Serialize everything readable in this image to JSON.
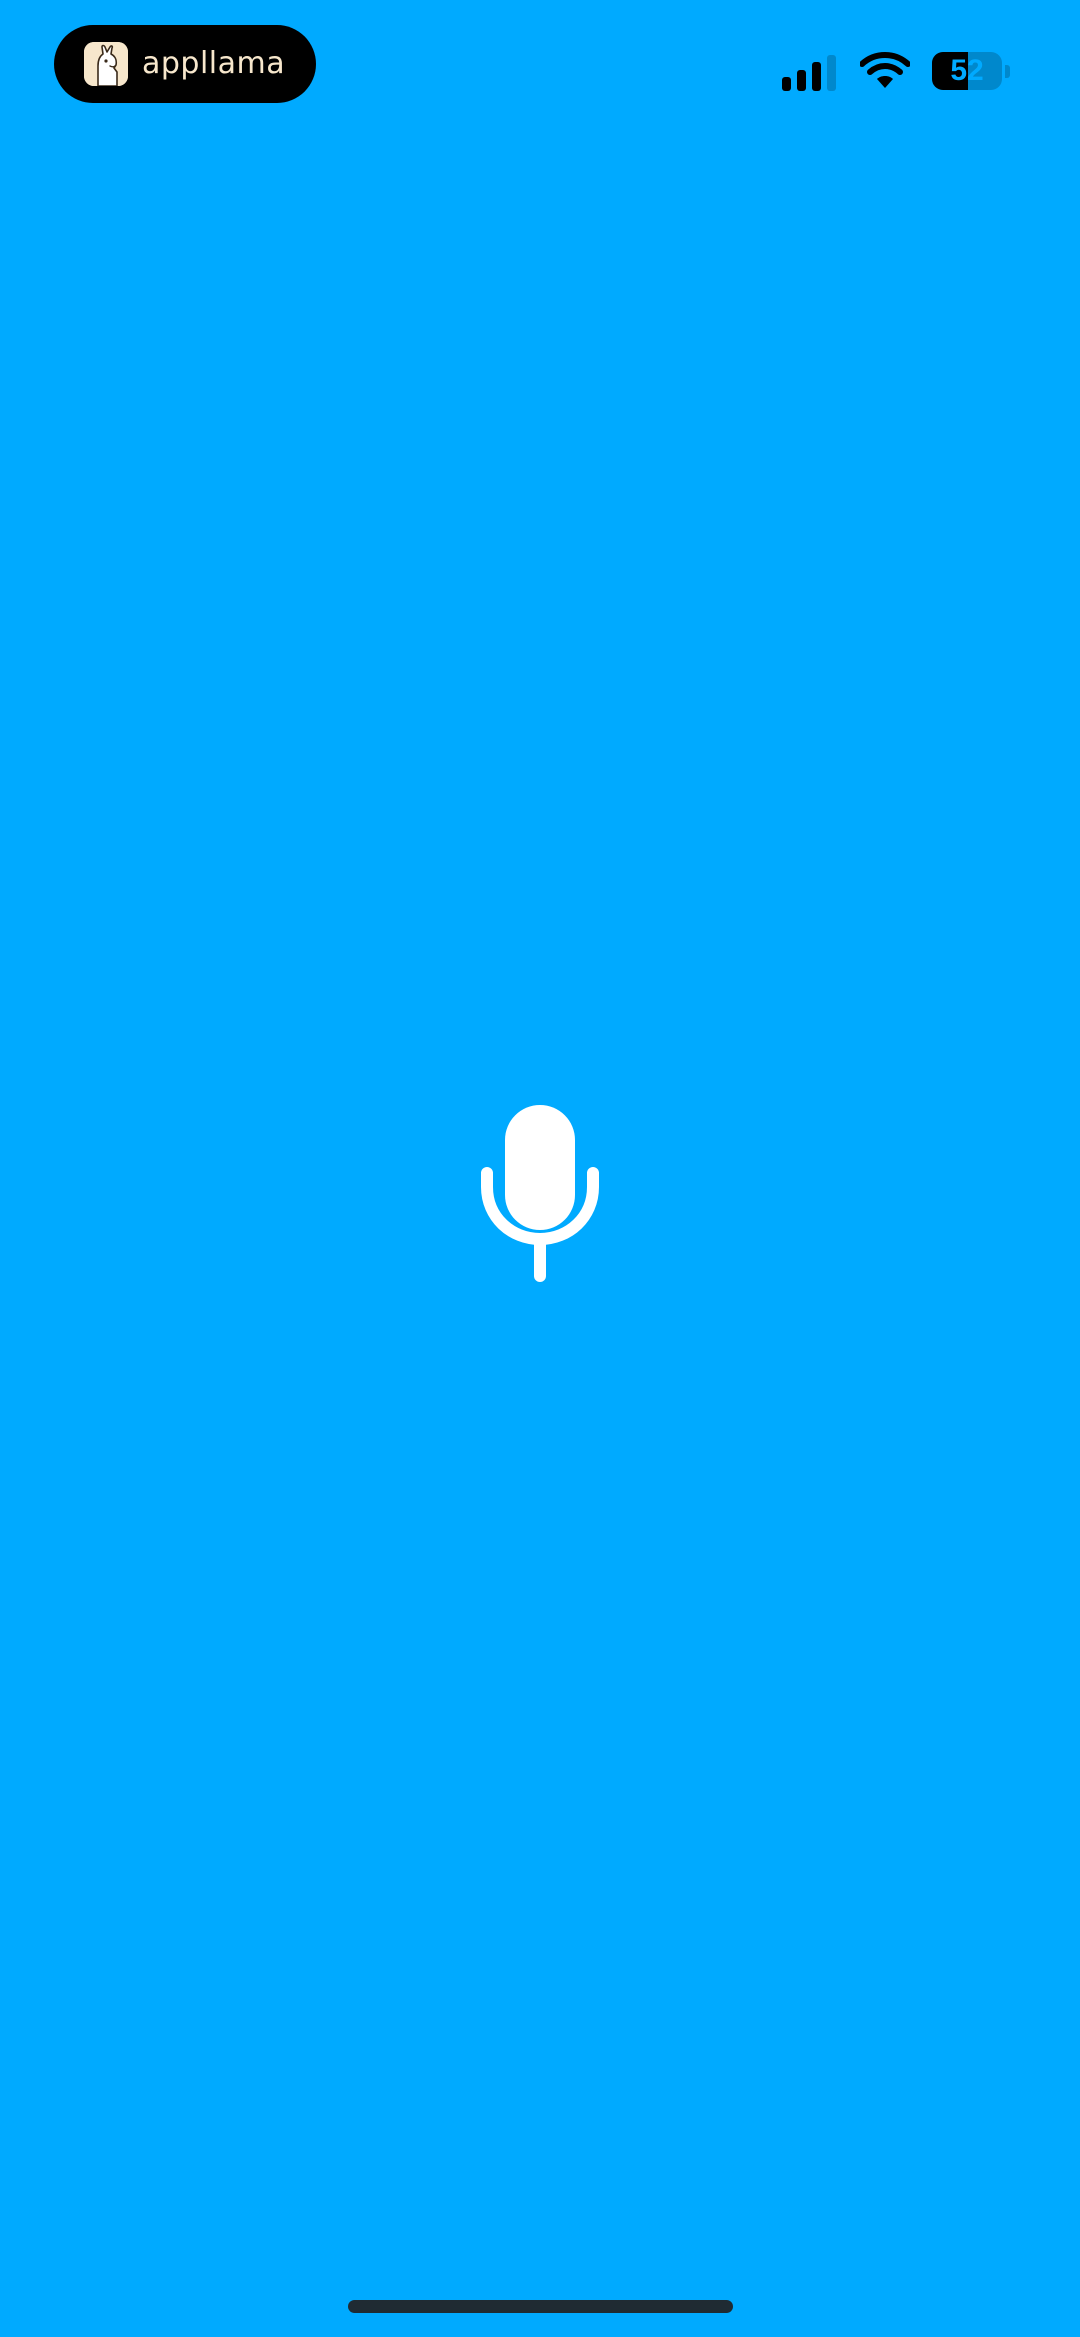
{
  "app_badge": {
    "name": "appllama",
    "icon": "llama-icon"
  },
  "status_bar": {
    "signal_icon": "cellular-signal-icon",
    "signal_bars_filled": 3,
    "signal_bars_total": 4,
    "wifi_icon": "wifi-icon",
    "battery_icon": "battery-icon",
    "battery_level": "52",
    "battery_fraction": 0.52
  },
  "main": {
    "icon": "microphone-icon"
  },
  "colors": {
    "background": "#00aaff",
    "badge_background": "#000000",
    "badge_text": "#f7e7cc",
    "mic": "#ffffff",
    "home_indicator": "#1f2b33"
  }
}
